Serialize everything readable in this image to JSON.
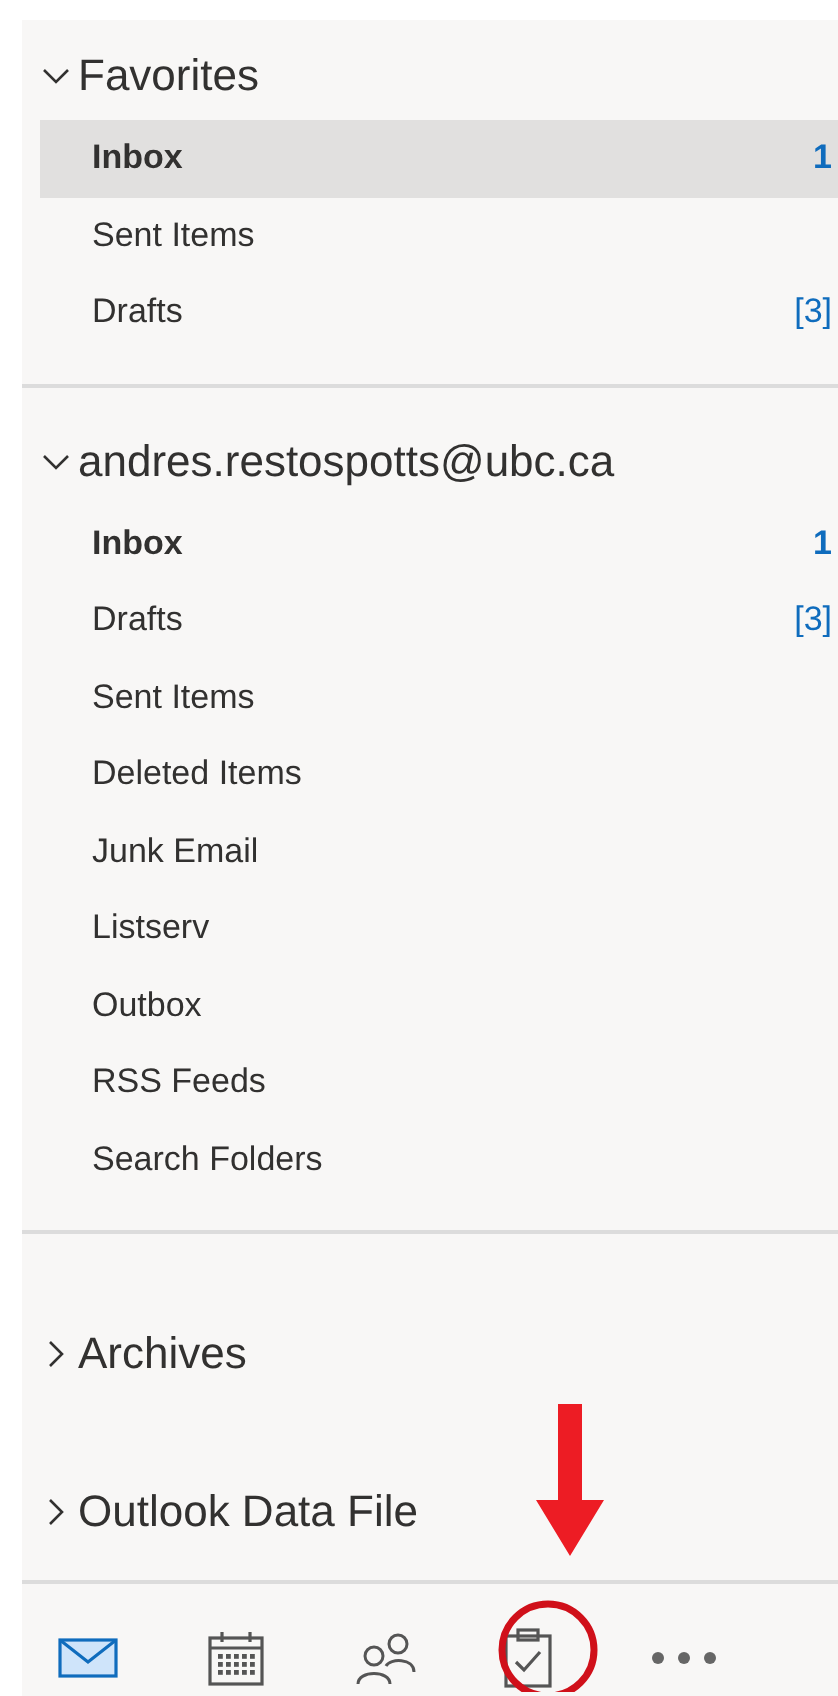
{
  "sections": [
    {
      "title": "Favorites",
      "expanded": true,
      "items": [
        {
          "name": "Inbox",
          "count": "1",
          "unread": true,
          "selected": true
        },
        {
          "name": "Sent Items",
          "unread": false,
          "selected": false
        },
        {
          "name": "Drafts",
          "count": "[3]",
          "unread": false,
          "selected": false
        }
      ]
    },
    {
      "title": "andres.restospotts@ubc.ca",
      "expanded": true,
      "items": [
        {
          "name": "Inbox",
          "count": "1",
          "unread": true,
          "selected": false
        },
        {
          "name": "Drafts",
          "count": "[3]",
          "unread": false,
          "selected": false
        },
        {
          "name": "Sent Items",
          "unread": false,
          "selected": false
        },
        {
          "name": "Deleted Items",
          "unread": false,
          "selected": false
        },
        {
          "name": "Junk Email",
          "unread": false,
          "selected": false
        },
        {
          "name": "Listserv",
          "unread": false,
          "selected": false
        },
        {
          "name": "Outbox",
          "unread": false,
          "selected": false
        },
        {
          "name": "RSS Feeds",
          "unread": false,
          "selected": false
        },
        {
          "name": "Search Folders",
          "unread": false,
          "selected": false
        }
      ]
    },
    {
      "title": "Archives",
      "expanded": false
    },
    {
      "title": "Outlook Data File",
      "expanded": false
    }
  ],
  "nav": [
    {
      "kind": "mail",
      "selected": true,
      "highlighted": false
    },
    {
      "kind": "calendar",
      "selected": false,
      "highlighted": false
    },
    {
      "kind": "people",
      "selected": false,
      "highlighted": false
    },
    {
      "kind": "tasks",
      "selected": false,
      "highlighted": true
    },
    {
      "kind": "more",
      "selected": false,
      "highlighted": false
    }
  ]
}
